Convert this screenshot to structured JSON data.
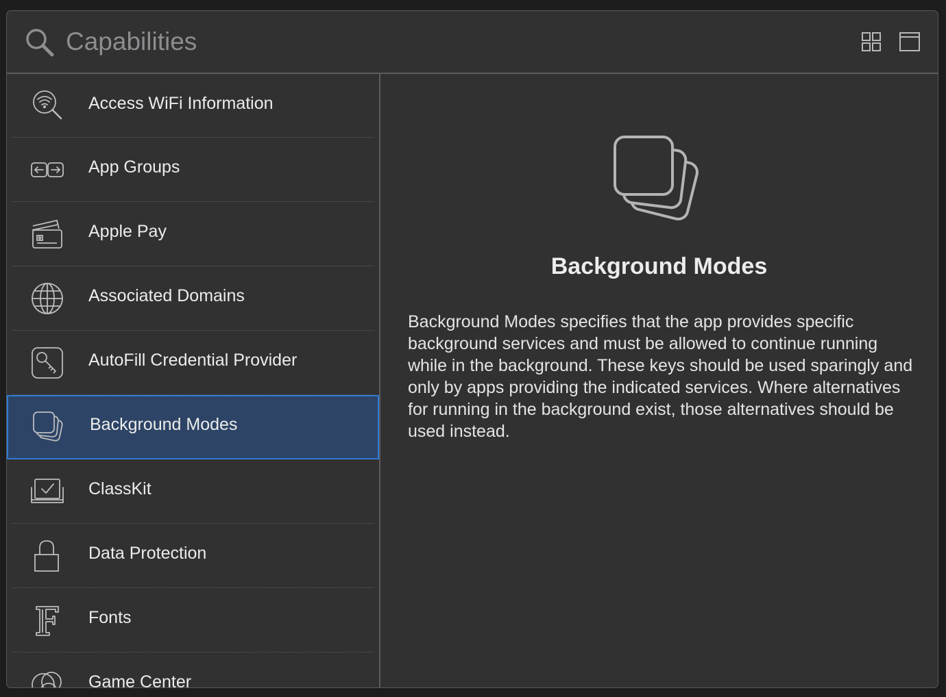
{
  "search": {
    "placeholder": "Capabilities",
    "icon": "search-icon"
  },
  "toolbar": {
    "grid_view_icon": "grid-view-icon",
    "single_view_icon": "single-view-icon"
  },
  "sidebar": {
    "items": [
      {
        "label": "Access WiFi Information",
        "icon": "wifi-search-icon",
        "selected": false
      },
      {
        "label": "App Groups",
        "icon": "app-groups-icon",
        "selected": false
      },
      {
        "label": "Apple Pay",
        "icon": "apple-pay-card-icon",
        "selected": false
      },
      {
        "label": "Associated Domains",
        "icon": "globe-icon",
        "selected": false
      },
      {
        "label": "AutoFill Credential Provider",
        "icon": "key-icon",
        "selected": false
      },
      {
        "label": "Background Modes",
        "icon": "stacked-squares-icon",
        "selected": true
      },
      {
        "label": "ClassKit",
        "icon": "classkit-checkbox-icon",
        "selected": false
      },
      {
        "label": "Data Protection",
        "icon": "lock-icon",
        "selected": false
      },
      {
        "label": "Fonts",
        "icon": "font-icon",
        "selected": false
      },
      {
        "label": "Game Center",
        "icon": "game-center-icon",
        "selected": false
      }
    ]
  },
  "detail": {
    "title": "Background Modes",
    "description": "Background Modes specifies that the app provides specific background services and must be allowed to continue running while in the background. These keys should be used sparingly and only by apps providing the indicated services. Where alternatives for running in the background exist, those alternatives should be used instead.",
    "icon": "stacked-squares-icon"
  },
  "colors": {
    "window_bg": "#313132",
    "selection_bg": "#2d4466",
    "selection_border": "#2f7ad6",
    "text": "#ececec",
    "placeholder": "#8d8d90"
  }
}
